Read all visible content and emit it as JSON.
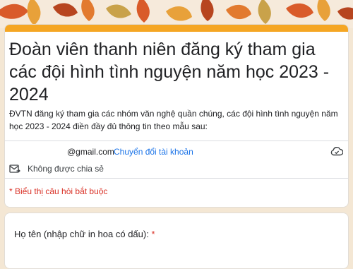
{
  "form": {
    "title": "Đoàn viên thanh niên đăng ký tham gia các đội hình tình nguyện năm học 2023 - 2024",
    "description": "ĐVTN đăng ký tham gia các nhóm văn nghệ quần chúng, các đội hình tình nguyện năm học 2023 - 2024 điền đầy đủ thông tin theo mẫu sau:",
    "account_email": "@gmail.com",
    "switch_account": "Chuyển đổi tài khoản",
    "not_shared": "Không được chia sẻ",
    "required_note": "* Biểu thị câu hỏi bắt buộc"
  },
  "question": {
    "label": "Họ tên (nhập chữ in hoa có dấu): ",
    "required_mark": "*"
  },
  "icons": {
    "cloud": "cloud-saved-icon",
    "share": "not-shared-icon"
  },
  "colors": {
    "accent": "#f5a623",
    "link": "#1a73e8",
    "required": "#d93025",
    "background": "#f4e7d4"
  }
}
